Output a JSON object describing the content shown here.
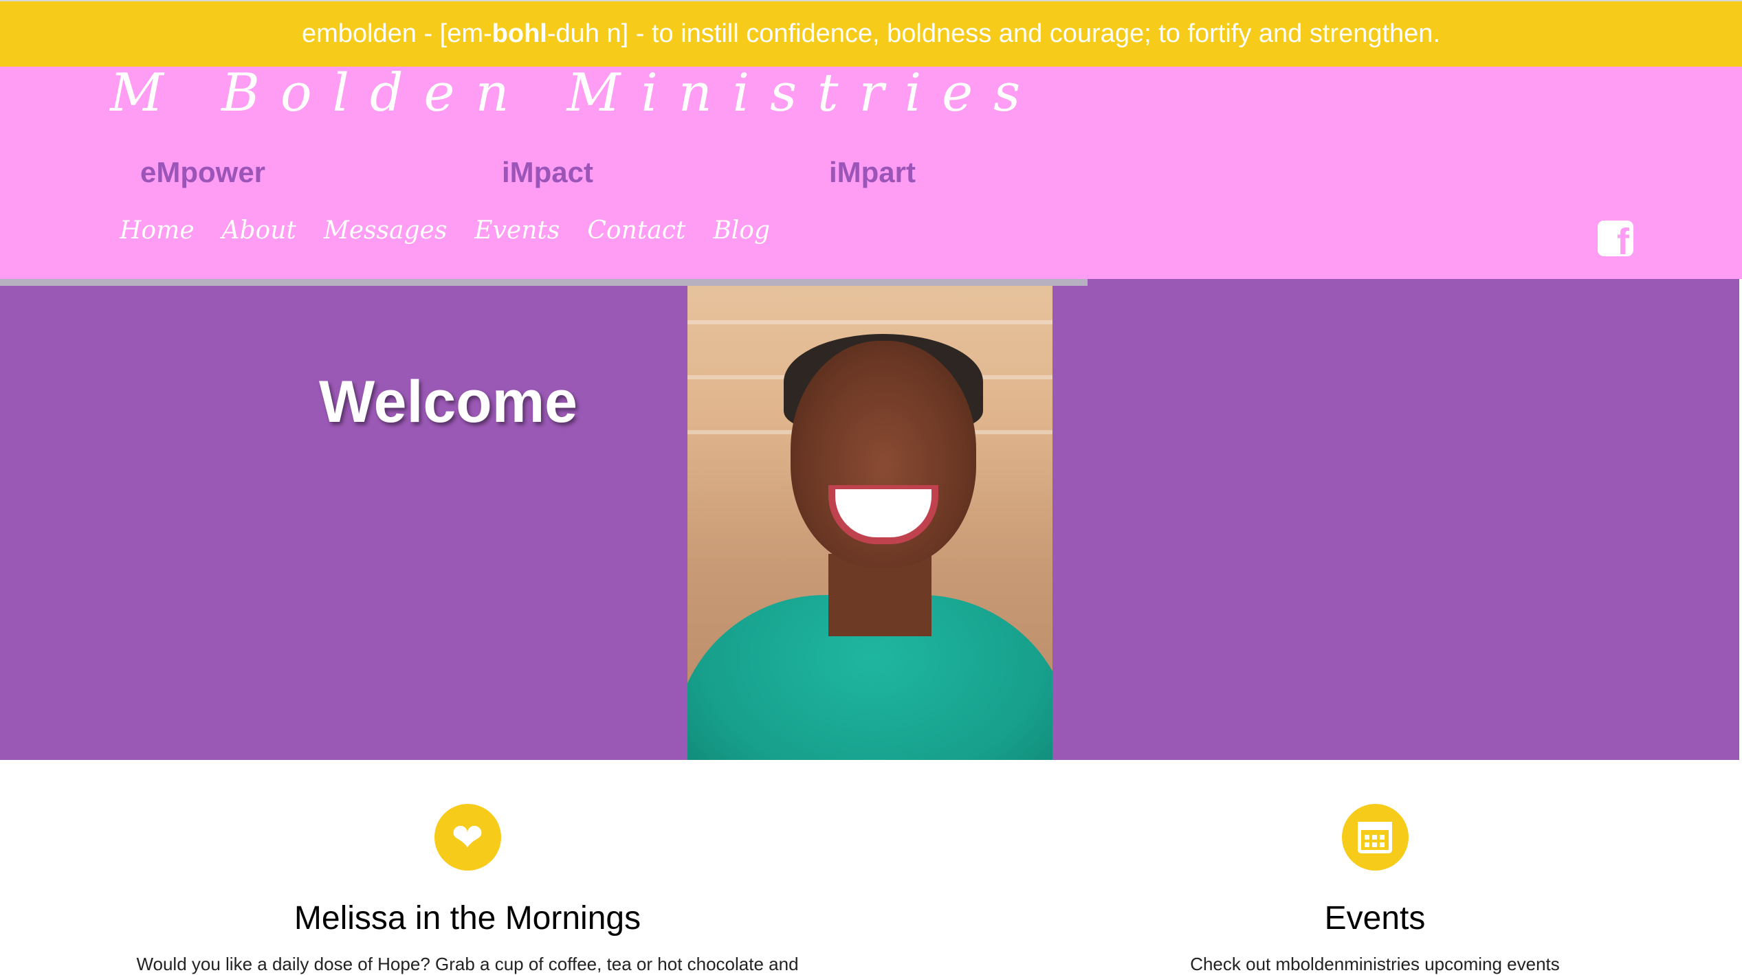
{
  "banner": {
    "prefix": "embolden - [em-",
    "bold": "bohl",
    "suffix": "-duh n] - to instill confidence, boldness and courage; to fortify and strengthen."
  },
  "brand": {
    "title": "M Bolden Ministries"
  },
  "pillars": [
    "eMpower",
    "iMpact",
    "iMpart"
  ],
  "nav": {
    "items": [
      "Home",
      "About",
      "Messages",
      "Events",
      "Contact",
      "Blog"
    ]
  },
  "social": {
    "icon": "facebook-icon"
  },
  "hero": {
    "heading": "Welcome"
  },
  "cards": [
    {
      "icon": "heart-icon",
      "title": "Melissa in the Mornings",
      "text": "Would you like a daily dose of Hope?  Grab a cup of coffee, tea or hot chocolate and"
    },
    {
      "icon": "calendar-icon",
      "title": "Events",
      "text": "Check out mboldenministries upcoming events"
    }
  ],
  "colors": {
    "banner": "#f6cb1a",
    "header": "#ff9cf3",
    "hero": "#9b59b6",
    "pillar_text": "#9b55b8",
    "icon_circle": "#f6cb1a"
  }
}
